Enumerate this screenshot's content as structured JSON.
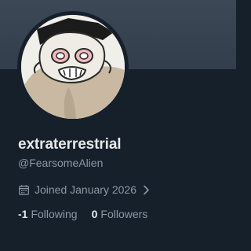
{
  "profile": {
    "display_name": "extraterrestrial",
    "handle": "@FearsomeAlien",
    "joined": "Joined January 2026",
    "following_count": "-1",
    "following_label": "Following",
    "followers_count": "0",
    "followers_label": "Followers"
  },
  "icons": {
    "calendar": "calendar-icon",
    "chevron": "chevron-right-icon"
  },
  "colors": {
    "background": "#15202b",
    "primary_text": "#e7e9ea",
    "secondary_text": "#8b98a5"
  }
}
